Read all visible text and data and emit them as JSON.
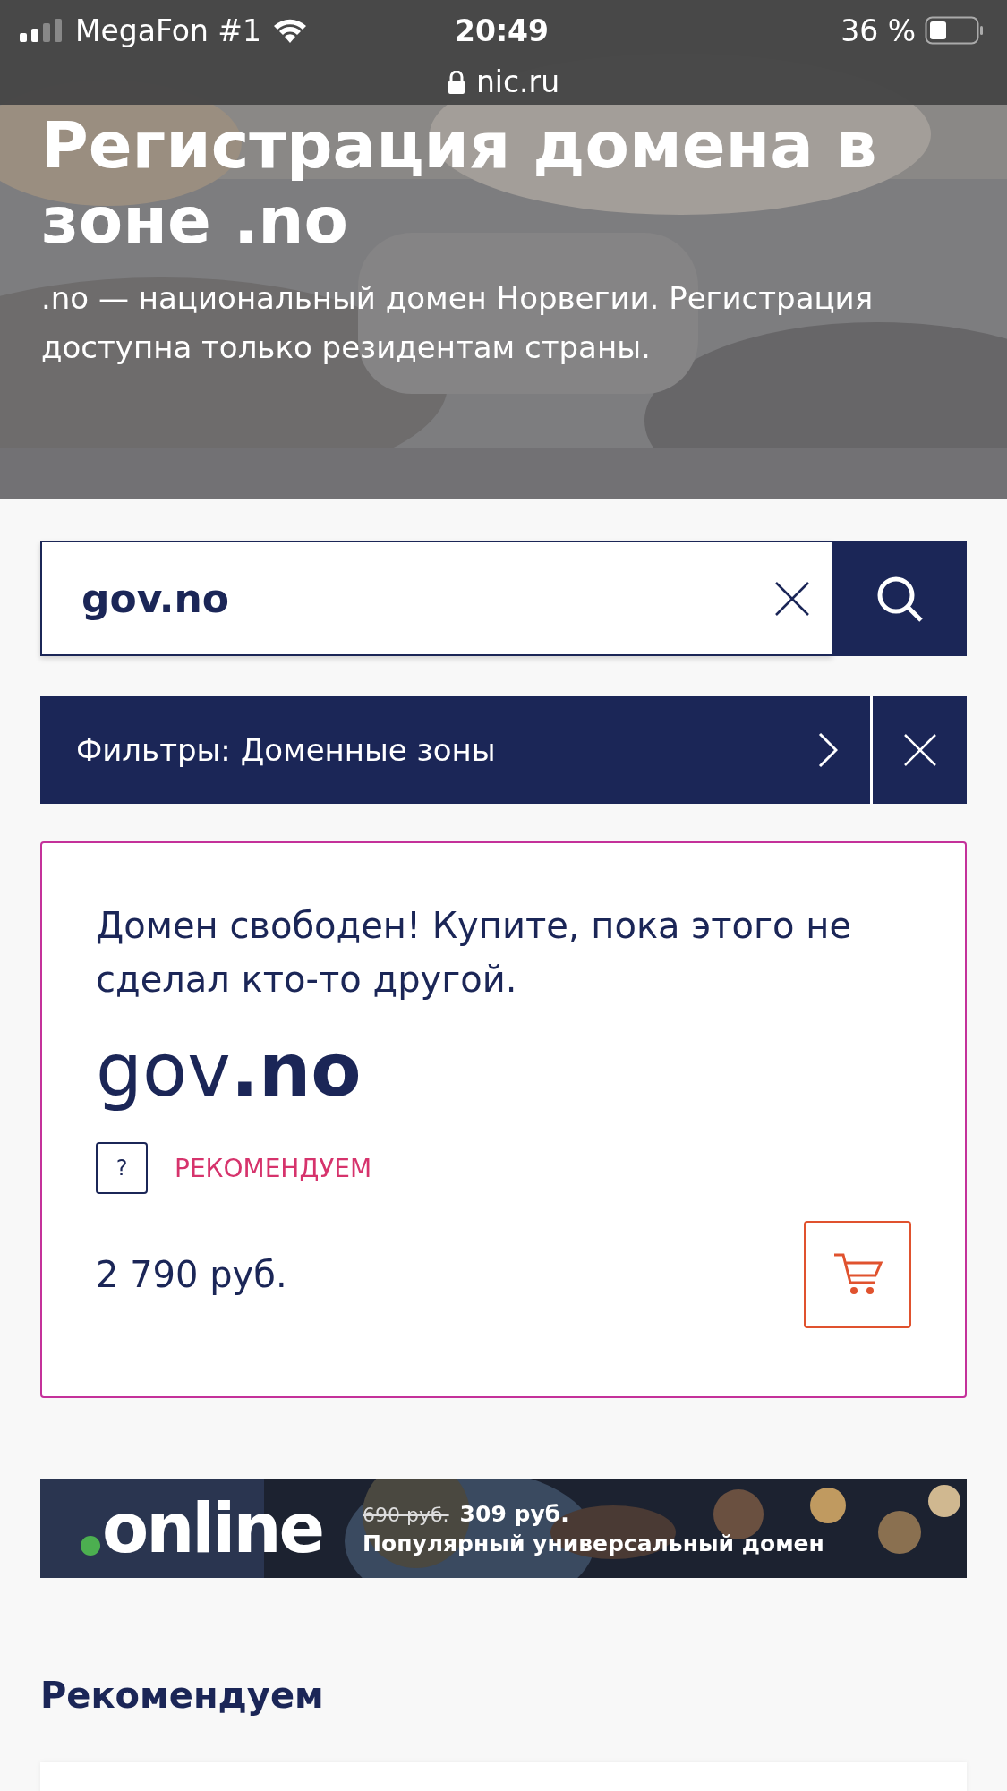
{
  "status_bar": {
    "carrier": "MegaFon #1",
    "time": "20:49",
    "url": "nic.ru",
    "battery": "36 %"
  },
  "hero": {
    "title": "Регистрация домена в зоне .no",
    "subtitle": ".no — национальный домен Норвегии. Регистрация доступна только резидентам страны."
  },
  "search": {
    "value": "gov.no"
  },
  "filter": {
    "label": "Фильтры: Доменные зоны"
  },
  "result": {
    "message": "Домен свободен! Купите, пока этого не сделал кто-то другой.",
    "domain_name": "gov",
    "domain_zone": ".no",
    "help": "?",
    "badge": "РЕКОМЕНДУЕМ",
    "price": "2 790 руб."
  },
  "banner": {
    "logo": "online",
    "old_price": "690 руб.",
    "new_price": "309 руб.",
    "tagline": "Популярный универсальный домен"
  },
  "section_title": "Рекомендуем"
}
